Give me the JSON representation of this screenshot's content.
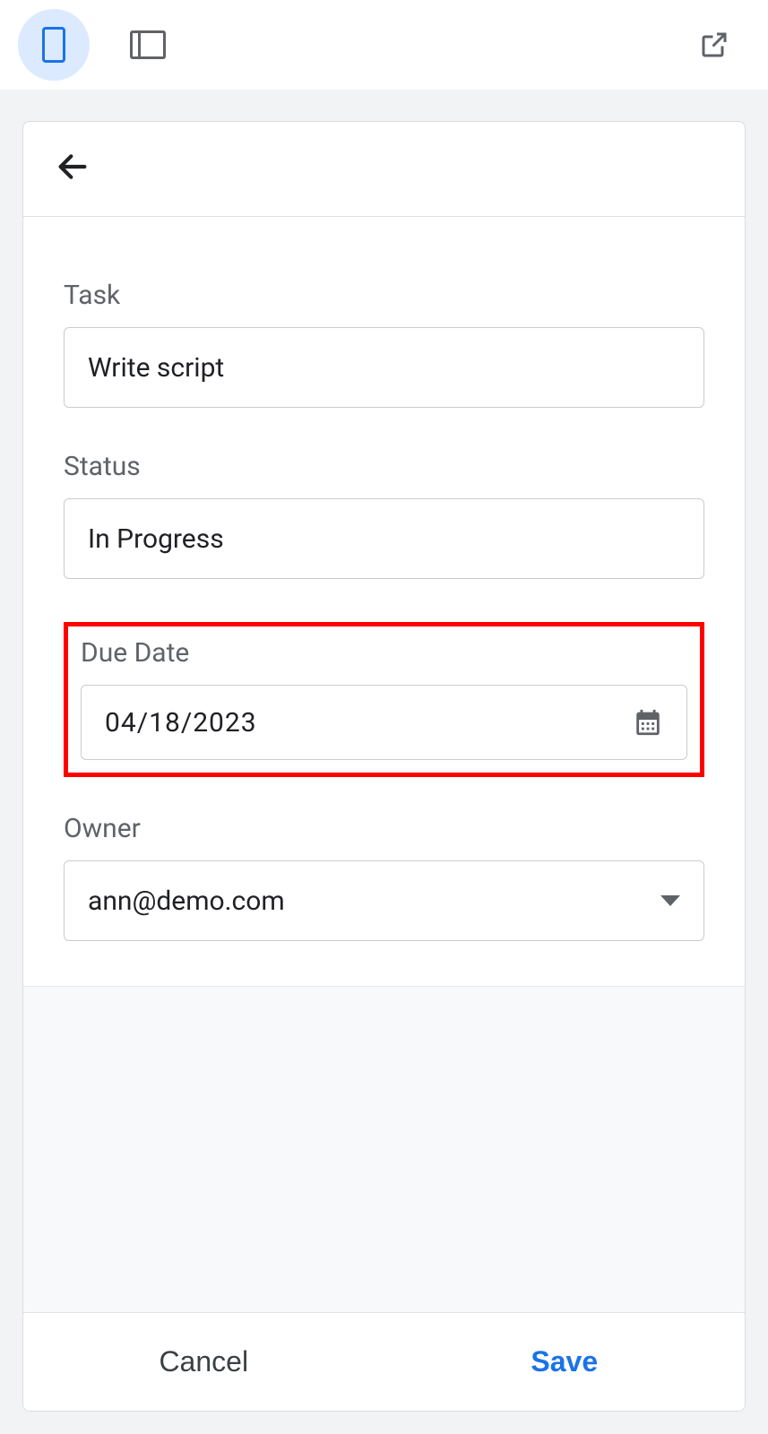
{
  "toolbar": {
    "mobile_view_active": true
  },
  "form": {
    "task": {
      "label": "Task",
      "value": "Write script"
    },
    "status": {
      "label": "Status",
      "value": "In Progress"
    },
    "due_date": {
      "label": "Due Date",
      "value": "04/18/2023"
    },
    "owner": {
      "label": "Owner",
      "value": "ann@demo.com"
    }
  },
  "actions": {
    "cancel": "Cancel",
    "save": "Save"
  }
}
